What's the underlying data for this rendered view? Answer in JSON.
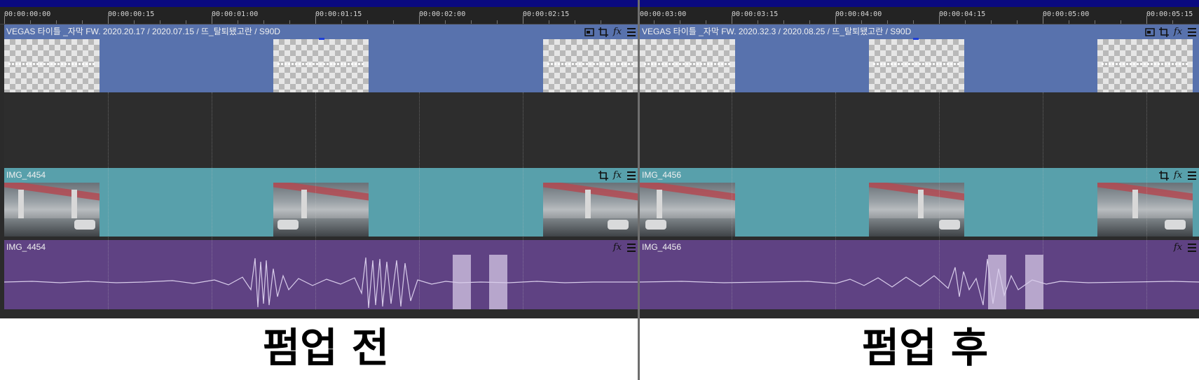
{
  "panels": [
    {
      "ruler_labels": [
        "00:00:00:00",
        "00:00:00:15",
        "00:00:01:00",
        "00:00:01:15",
        "00:00:02:00",
        "00:00:02:15"
      ],
      "title_track_label": "VEGAS 타이틀 _자막 FW. 2020.20.17 / 2020.07.15 / 뜨_탈퇴됐고란 / S90D",
      "video_track_label": "IMG_4454",
      "audio_track_label": "IMG_4454",
      "caption": "펌업 전"
    },
    {
      "ruler_labels": [
        "00:00:03:00",
        "00:00:03:15",
        "00:00:04:00",
        "00:00:04:15",
        "00:00:05:00",
        "00:00:05:15"
      ],
      "title_track_label": "VEGAS 타이틀 _자막 FW. 2020.32.3 / 2020.08.25 / 뜨_탈퇴됐고란 / S90D",
      "video_track_label": "IMG_4456",
      "audio_track_label": "IMG_4456",
      "caption": "펌업 후"
    }
  ],
  "icons": {
    "track_media": "media-icon",
    "crop": "crop-icon",
    "fx": "fx-icon",
    "menu": "hamburger-menu-icon"
  },
  "colors": {
    "title_track": "#5872ad",
    "video_track": "#58a0ab",
    "audio_track": "#5f4283",
    "timeline_bg": "#2b2b2b",
    "top_bar": "#0a0a80"
  }
}
